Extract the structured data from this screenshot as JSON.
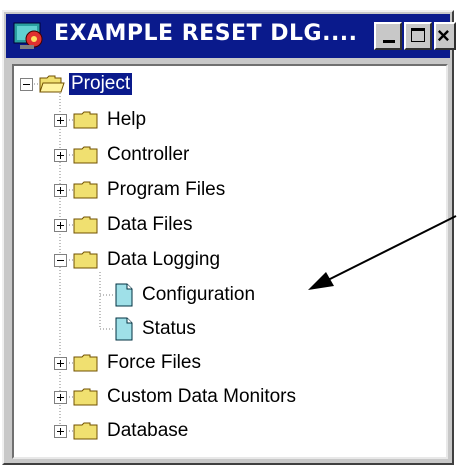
{
  "window": {
    "title": "EXAMPLE RESET DLG....",
    "controls": {
      "minimize": "minimize",
      "maximize": "maximize",
      "close": "×"
    }
  },
  "tree": {
    "root": {
      "label": "Project",
      "expanded": true,
      "selected": true
    },
    "items": [
      {
        "label": "Help",
        "type": "folder",
        "expander": "+"
      },
      {
        "label": "Controller",
        "type": "folder",
        "expander": "+"
      },
      {
        "label": "Program Files",
        "type": "folder",
        "expander": "+"
      },
      {
        "label": "Data Files",
        "type": "folder",
        "expander": "+"
      },
      {
        "label": "Data Logging",
        "type": "folder",
        "expander": "-",
        "children": [
          {
            "label": "Configuration",
            "type": "document"
          },
          {
            "label": "Status",
            "type": "document"
          }
        ]
      },
      {
        "label": "Force Files",
        "type": "folder",
        "expander": "+"
      },
      {
        "label": "Custom Data Monitors",
        "type": "folder",
        "expander": "+"
      },
      {
        "label": "Database",
        "type": "folder",
        "expander": "+"
      }
    ]
  },
  "colors": {
    "titlebar": "#0a1a8c",
    "folder": "#f0e070",
    "document": "#9fe0e8",
    "selection": "#0a1a8c"
  },
  "icons": {
    "folder": "folder-icon",
    "document": "document-icon",
    "app": "app-icon"
  }
}
